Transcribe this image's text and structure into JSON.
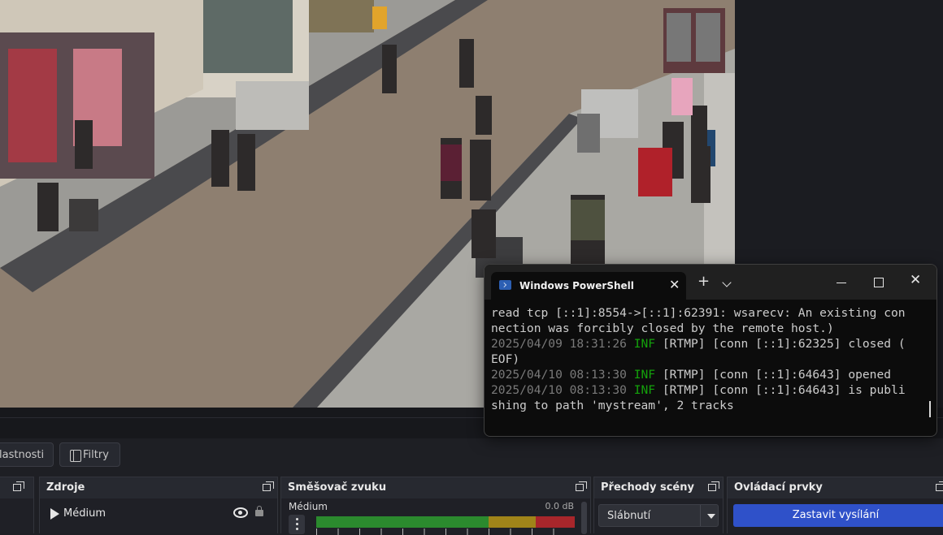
{
  "properties_bar": {
    "properties_label": "lastnosti",
    "filters_label": "Filtry"
  },
  "docks": {
    "sources": {
      "title": "Zdroje",
      "items": [
        {
          "name": "Médium",
          "icon": "play-icon",
          "visible": true,
          "locked": false
        }
      ]
    },
    "mixer": {
      "title": "Směšovač zvuku",
      "channels": [
        {
          "name": "Médium",
          "level_db": "0.0 dB"
        }
      ]
    },
    "transitions": {
      "title": "Přechody scény",
      "selected": "Slábnutí"
    },
    "controls": {
      "title": "Ovládací prvky",
      "stream_button": "Zastavit vysílání"
    }
  },
  "powershell": {
    "tab_title": "Windows PowerShell",
    "lines": [
      {
        "text": "read tcp [::1]:8554->[::1]:62391: wsarecv: An existing con"
      },
      {
        "text": "nection was forcibly closed by the remote host.)"
      },
      {
        "ts": "2025/04/09 18:31:26",
        "level": "INF",
        "text": " [RTMP] [conn [::1]:62325] closed ("
      },
      {
        "text": "EOF)"
      },
      {
        "ts": "2025/04/10 08:13:30",
        "level": "INF",
        "text": " [RTMP] [conn [::1]:64643] opened"
      },
      {
        "ts": "2025/04/10 08:13:30",
        "level": "INF",
        "text": " [RTMP] [conn [::1]:64643] is publi"
      },
      {
        "text": "shing to path 'mystream', 2 tracks"
      }
    ]
  },
  "colors": {
    "accent_stream": "#2f51c9",
    "log_info": "#14a30b",
    "meter_green": "#2b8a2e",
    "meter_yellow": "#a08419",
    "meter_red": "#a8262b"
  }
}
